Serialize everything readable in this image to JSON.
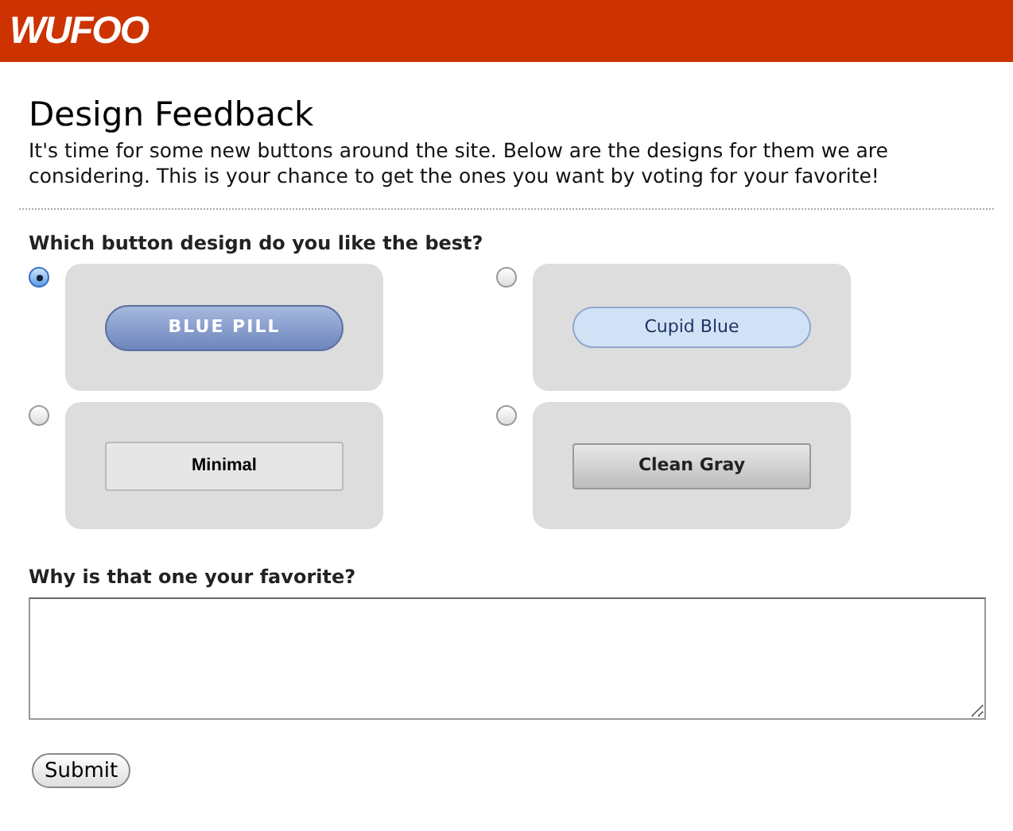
{
  "header": {
    "logo": "WUFOO"
  },
  "form": {
    "title": "Design Feedback",
    "description": "It's time for some new buttons around the site. Below are the designs for them we are considering. This is your chance to get the ones you want by voting for your favorite!",
    "question_1": {
      "label": "Which button design do you like the best?",
      "options": [
        {
          "label": "BLUE PILL",
          "kind": "pill",
          "selected": true
        },
        {
          "label": "Cupid Blue",
          "kind": "cupid",
          "selected": false
        },
        {
          "label": "Minimal",
          "kind": "minimal",
          "selected": false
        },
        {
          "label": "Clean Gray",
          "kind": "gray",
          "selected": false
        }
      ]
    },
    "question_2": {
      "label": "Why is that one your favorite?"
    },
    "submit": "Submit"
  }
}
